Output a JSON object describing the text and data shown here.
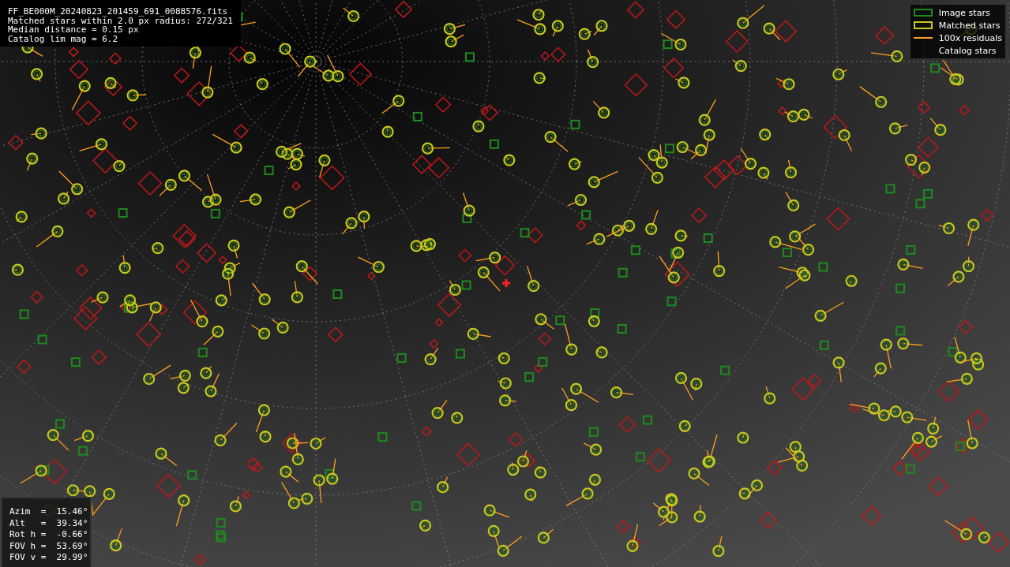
{
  "header_lines": [
    "FF_BE000M_20240823_201459_691_0088576.fits",
    "Matched stars within 2.0 px radius: 272/321",
    "Median distance = 0.15 px",
    "Catalog lim mag = 6.2"
  ],
  "legend": [
    {
      "kind": "image",
      "label": "Image stars"
    },
    {
      "kind": "matched",
      "label": "Matched stars"
    },
    {
      "kind": "residual",
      "label": "100x residuals"
    },
    {
      "kind": "catalog",
      "label": "Catalog stars"
    }
  ],
  "pointing": [
    "Azim  =  15.46°",
    "Alt   =  39.34°",
    "Rot h =  -0.66°",
    "FOV h =  53.69°",
    "FOV v =  29.99°"
  ]
}
